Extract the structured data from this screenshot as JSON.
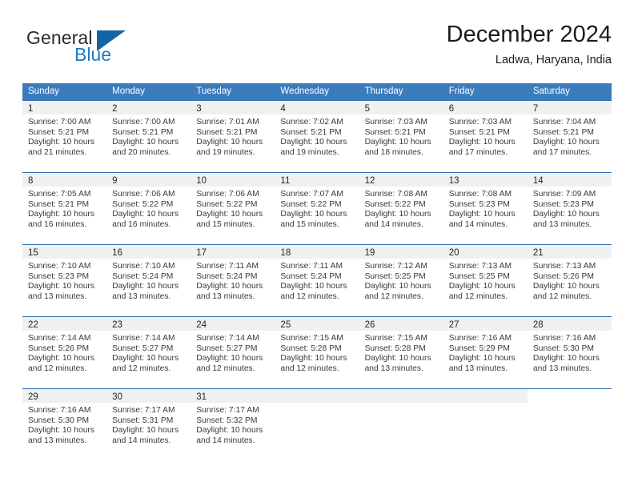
{
  "brand": {
    "name_top": "General",
    "name_bottom": "Blue",
    "accent_color": "#1464a5",
    "blue_text_color": "#1f7ac0"
  },
  "header": {
    "title": "December 2024",
    "location": "Ladwa, Haryana, India"
  },
  "calendar": {
    "header_bg": "#3b7cbd",
    "row_border": "#2f6fae",
    "daynum_bg": "#f0f0f0",
    "weekdays": [
      "Sunday",
      "Monday",
      "Tuesday",
      "Wednesday",
      "Thursday",
      "Friday",
      "Saturday"
    ],
    "weeks": [
      [
        {
          "day": "1",
          "sunrise": "Sunrise: 7:00 AM",
          "sunset": "Sunset: 5:21 PM",
          "daylight1": "Daylight: 10 hours",
          "daylight2": "and 21 minutes."
        },
        {
          "day": "2",
          "sunrise": "Sunrise: 7:00 AM",
          "sunset": "Sunset: 5:21 PM",
          "daylight1": "Daylight: 10 hours",
          "daylight2": "and 20 minutes."
        },
        {
          "day": "3",
          "sunrise": "Sunrise: 7:01 AM",
          "sunset": "Sunset: 5:21 PM",
          "daylight1": "Daylight: 10 hours",
          "daylight2": "and 19 minutes."
        },
        {
          "day": "4",
          "sunrise": "Sunrise: 7:02 AM",
          "sunset": "Sunset: 5:21 PM",
          "daylight1": "Daylight: 10 hours",
          "daylight2": "and 19 minutes."
        },
        {
          "day": "5",
          "sunrise": "Sunrise: 7:03 AM",
          "sunset": "Sunset: 5:21 PM",
          "daylight1": "Daylight: 10 hours",
          "daylight2": "and 18 minutes."
        },
        {
          "day": "6",
          "sunrise": "Sunrise: 7:03 AM",
          "sunset": "Sunset: 5:21 PM",
          "daylight1": "Daylight: 10 hours",
          "daylight2": "and 17 minutes."
        },
        {
          "day": "7",
          "sunrise": "Sunrise: 7:04 AM",
          "sunset": "Sunset: 5:21 PM",
          "daylight1": "Daylight: 10 hours",
          "daylight2": "and 17 minutes."
        }
      ],
      [
        {
          "day": "8",
          "sunrise": "Sunrise: 7:05 AM",
          "sunset": "Sunset: 5:21 PM",
          "daylight1": "Daylight: 10 hours",
          "daylight2": "and 16 minutes."
        },
        {
          "day": "9",
          "sunrise": "Sunrise: 7:06 AM",
          "sunset": "Sunset: 5:22 PM",
          "daylight1": "Daylight: 10 hours",
          "daylight2": "and 16 minutes."
        },
        {
          "day": "10",
          "sunrise": "Sunrise: 7:06 AM",
          "sunset": "Sunset: 5:22 PM",
          "daylight1": "Daylight: 10 hours",
          "daylight2": "and 15 minutes."
        },
        {
          "day": "11",
          "sunrise": "Sunrise: 7:07 AM",
          "sunset": "Sunset: 5:22 PM",
          "daylight1": "Daylight: 10 hours",
          "daylight2": "and 15 minutes."
        },
        {
          "day": "12",
          "sunrise": "Sunrise: 7:08 AM",
          "sunset": "Sunset: 5:22 PM",
          "daylight1": "Daylight: 10 hours",
          "daylight2": "and 14 minutes."
        },
        {
          "day": "13",
          "sunrise": "Sunrise: 7:08 AM",
          "sunset": "Sunset: 5:23 PM",
          "daylight1": "Daylight: 10 hours",
          "daylight2": "and 14 minutes."
        },
        {
          "day": "14",
          "sunrise": "Sunrise: 7:09 AM",
          "sunset": "Sunset: 5:23 PM",
          "daylight1": "Daylight: 10 hours",
          "daylight2": "and 13 minutes."
        }
      ],
      [
        {
          "day": "15",
          "sunrise": "Sunrise: 7:10 AM",
          "sunset": "Sunset: 5:23 PM",
          "daylight1": "Daylight: 10 hours",
          "daylight2": "and 13 minutes."
        },
        {
          "day": "16",
          "sunrise": "Sunrise: 7:10 AM",
          "sunset": "Sunset: 5:24 PM",
          "daylight1": "Daylight: 10 hours",
          "daylight2": "and 13 minutes."
        },
        {
          "day": "17",
          "sunrise": "Sunrise: 7:11 AM",
          "sunset": "Sunset: 5:24 PM",
          "daylight1": "Daylight: 10 hours",
          "daylight2": "and 13 minutes."
        },
        {
          "day": "18",
          "sunrise": "Sunrise: 7:11 AM",
          "sunset": "Sunset: 5:24 PM",
          "daylight1": "Daylight: 10 hours",
          "daylight2": "and 12 minutes."
        },
        {
          "day": "19",
          "sunrise": "Sunrise: 7:12 AM",
          "sunset": "Sunset: 5:25 PM",
          "daylight1": "Daylight: 10 hours",
          "daylight2": "and 12 minutes."
        },
        {
          "day": "20",
          "sunrise": "Sunrise: 7:13 AM",
          "sunset": "Sunset: 5:25 PM",
          "daylight1": "Daylight: 10 hours",
          "daylight2": "and 12 minutes."
        },
        {
          "day": "21",
          "sunrise": "Sunrise: 7:13 AM",
          "sunset": "Sunset: 5:26 PM",
          "daylight1": "Daylight: 10 hours",
          "daylight2": "and 12 minutes."
        }
      ],
      [
        {
          "day": "22",
          "sunrise": "Sunrise: 7:14 AM",
          "sunset": "Sunset: 5:26 PM",
          "daylight1": "Daylight: 10 hours",
          "daylight2": "and 12 minutes."
        },
        {
          "day": "23",
          "sunrise": "Sunrise: 7:14 AM",
          "sunset": "Sunset: 5:27 PM",
          "daylight1": "Daylight: 10 hours",
          "daylight2": "and 12 minutes."
        },
        {
          "day": "24",
          "sunrise": "Sunrise: 7:14 AM",
          "sunset": "Sunset: 5:27 PM",
          "daylight1": "Daylight: 10 hours",
          "daylight2": "and 12 minutes."
        },
        {
          "day": "25",
          "sunrise": "Sunrise: 7:15 AM",
          "sunset": "Sunset: 5:28 PM",
          "daylight1": "Daylight: 10 hours",
          "daylight2": "and 12 minutes."
        },
        {
          "day": "26",
          "sunrise": "Sunrise: 7:15 AM",
          "sunset": "Sunset: 5:28 PM",
          "daylight1": "Daylight: 10 hours",
          "daylight2": "and 13 minutes."
        },
        {
          "day": "27",
          "sunrise": "Sunrise: 7:16 AM",
          "sunset": "Sunset: 5:29 PM",
          "daylight1": "Daylight: 10 hours",
          "daylight2": "and 13 minutes."
        },
        {
          "day": "28",
          "sunrise": "Sunrise: 7:16 AM",
          "sunset": "Sunset: 5:30 PM",
          "daylight1": "Daylight: 10 hours",
          "daylight2": "and 13 minutes."
        }
      ],
      [
        {
          "day": "29",
          "sunrise": "Sunrise: 7:16 AM",
          "sunset": "Sunset: 5:30 PM",
          "daylight1": "Daylight: 10 hours",
          "daylight2": "and 13 minutes."
        },
        {
          "day": "30",
          "sunrise": "Sunrise: 7:17 AM",
          "sunset": "Sunset: 5:31 PM",
          "daylight1": "Daylight: 10 hours",
          "daylight2": "and 14 minutes."
        },
        {
          "day": "31",
          "sunrise": "Sunrise: 7:17 AM",
          "sunset": "Sunset: 5:32 PM",
          "daylight1": "Daylight: 10 hours",
          "daylight2": "and 14 minutes."
        },
        {
          "day": "",
          "sunrise": "",
          "sunset": "",
          "daylight1": "",
          "daylight2": ""
        },
        {
          "day": "",
          "sunrise": "",
          "sunset": "",
          "daylight1": "",
          "daylight2": ""
        },
        {
          "day": "",
          "sunrise": "",
          "sunset": "",
          "daylight1": "",
          "daylight2": ""
        },
        {
          "day": "",
          "sunrise": "",
          "sunset": "",
          "daylight1": "",
          "daylight2": ""
        }
      ]
    ]
  }
}
